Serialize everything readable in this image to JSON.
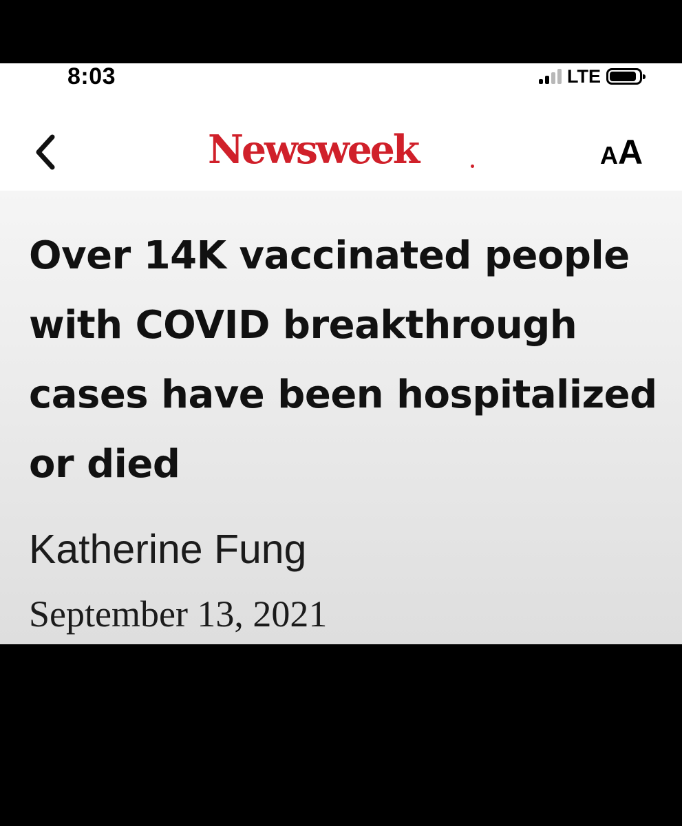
{
  "status_bar": {
    "time": "8:03",
    "network": "LTE",
    "signal_bars_active": 2,
    "signal_bars_total": 4,
    "battery_level": 0.9
  },
  "nav": {
    "back_icon": "chevron-left-icon",
    "logo": "Newsweek",
    "text_size_small": "A",
    "text_size_large": "A"
  },
  "article": {
    "headline": "Over 14K vaccinated people with COVID breakthrough cases have been hospitalized or died",
    "author": "Katherine Fung",
    "date": "September 13, 2021"
  },
  "colors": {
    "brand_red": "#d0202a",
    "header_bg_top": "#f5f5f5",
    "header_bg_bottom": "#dedede",
    "frame": "#000000"
  }
}
